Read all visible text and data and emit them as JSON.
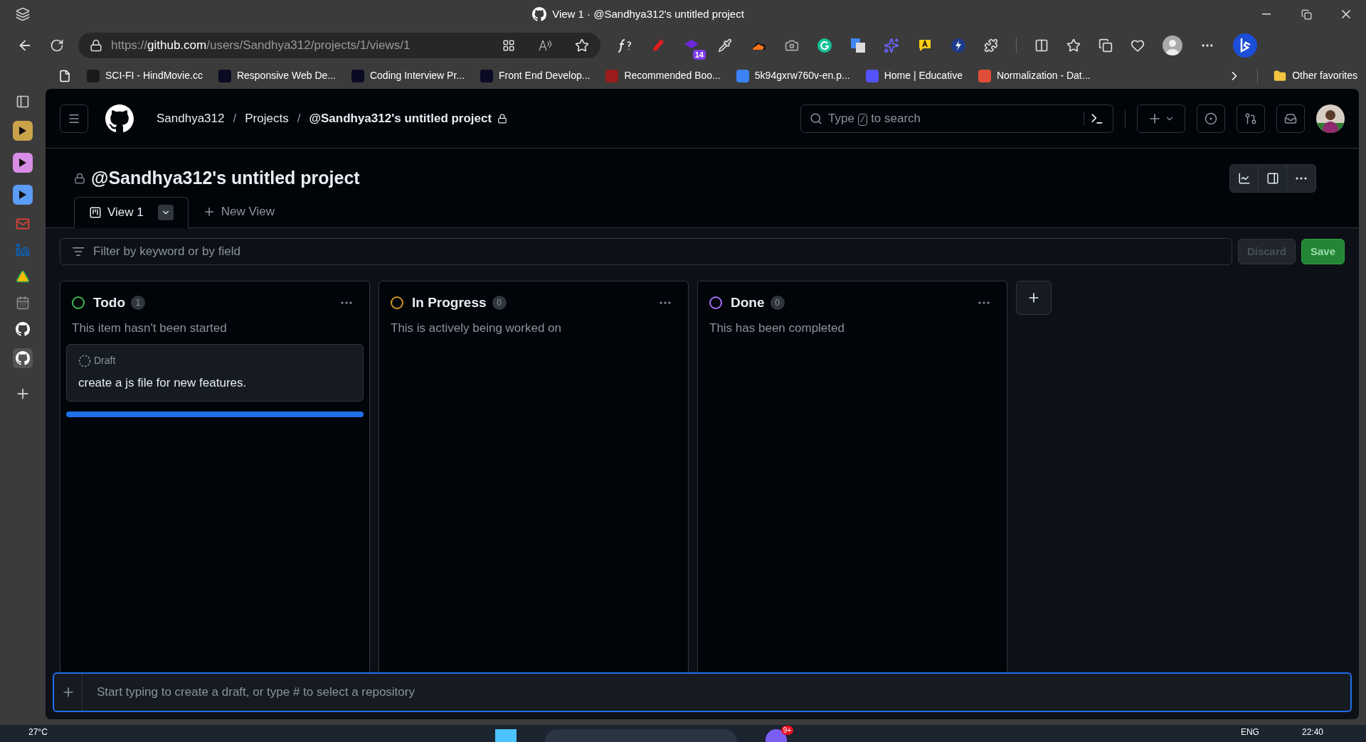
{
  "window": {
    "title": "View 1 · @Sandhya312's untitled project"
  },
  "browser": {
    "url_host": "github.com",
    "url_scheme": "https://",
    "url_path": "/users/Sandhya312/projects/1/views/1",
    "extension_badge": "14",
    "bookmarks": [
      {
        "label": "SCI-FI - HindMovie.cc",
        "color": "#1a1a1a"
      },
      {
        "label": "Responsive Web De...",
        "color": "#0a0a23"
      },
      {
        "label": "Coding Interview Pr...",
        "color": "#0a0a23"
      },
      {
        "label": "Front End Develop...",
        "color": "#0a0a23"
      },
      {
        "label": "Recommended Boo...",
        "color": "#9b1c1c"
      },
      {
        "label": "5k94gxrw760v-en.p...",
        "color": "#3b82f6"
      },
      {
        "label": "Home | Educative",
        "color": "#5553ff"
      },
      {
        "label": "Normalization - Dat...",
        "color": "#e04e39"
      }
    ],
    "other_favorites": "Other favorites"
  },
  "header": {
    "breadcrumbs": [
      "Sandhya312",
      "Projects",
      "@Sandhya312's untitled project"
    ],
    "separator": "/",
    "search": {
      "before": "Type",
      "key": "/",
      "after": "to search"
    }
  },
  "project": {
    "title": "@Sandhya312's untitled project",
    "tabs": [
      {
        "label": "View 1",
        "selected": true
      },
      {
        "label": "New View",
        "selected": false
      }
    ],
    "filter": {
      "placeholder": "Filter by keyword or by field"
    },
    "buttons": [
      {
        "label": "Discard",
        "disabled": true
      },
      {
        "label": "Save",
        "disabled": false
      }
    ],
    "columns": [
      {
        "name": "Todo",
        "count": "1",
        "description": "This item hasn't been started",
        "color": "#3fb950",
        "items": [
          {
            "kind": "draft",
            "label": "Draft",
            "title": "create a js file for new features."
          }
        ],
        "drop_indicator": true
      },
      {
        "name": "In Progress",
        "count": "0",
        "description": "This is actively being worked on",
        "color": "#d29922",
        "drop_indicator": false
      },
      {
        "name": "Done",
        "count": "0",
        "description": "This has been completed",
        "color": "#a371f7",
        "drop_indicator": false
      }
    ],
    "draft_input": {
      "placeholder": "Start typing to create a draft, or type # to select a repository"
    }
  },
  "taskbar": {
    "weather": "27°C",
    "language": "ENG",
    "time": "22:40",
    "badge": "9+"
  }
}
